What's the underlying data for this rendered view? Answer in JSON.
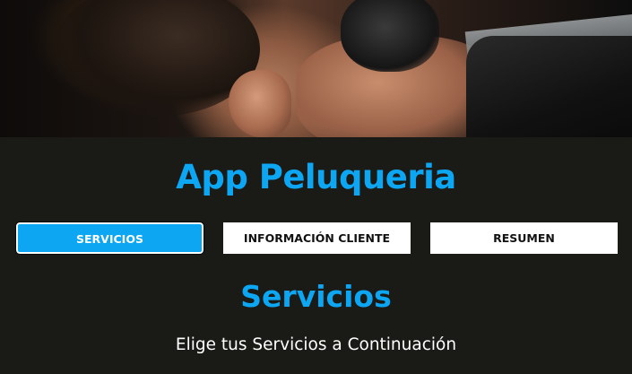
{
  "app": {
    "title": "App Peluqueria"
  },
  "hero": {
    "image_subject": "barber-cutting-hair-photo"
  },
  "tabs": [
    {
      "label": "SERVICIOS",
      "active": true
    },
    {
      "label": "INFORMACIÓN CLIENTE",
      "active": false
    },
    {
      "label": "RESUMEN",
      "active": false
    }
  ],
  "section": {
    "title": "Servicios",
    "subtitle": "Elige tus Servicios a Continuación"
  },
  "colors": {
    "accent": "#0da6f3",
    "background": "#1a1a16",
    "tab_inactive_bg": "#ffffff",
    "tab_text_dark": "#111111"
  }
}
